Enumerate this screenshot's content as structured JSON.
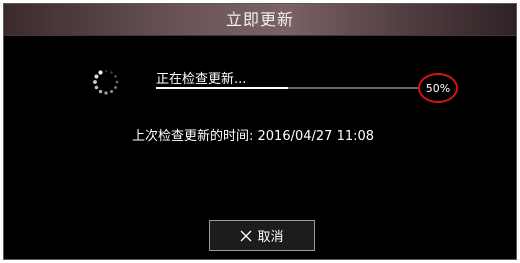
{
  "dialog": {
    "title": "立即更新",
    "status_text": "正在检查更新...",
    "progress_percent": 50,
    "progress_label": "50%",
    "last_check_text": "上次检查更新的时间: 2016/04/27 11:08",
    "cancel_label": "取消"
  },
  "icons": {
    "spinner": "loading-spinner-icon",
    "cancel": "close-x-icon"
  },
  "colors": {
    "background": "#000000",
    "text": "#ffffff",
    "highlight_circle": "#d41414",
    "progress_fill": "#ffffff",
    "progress_track": "#6a6a6a"
  }
}
